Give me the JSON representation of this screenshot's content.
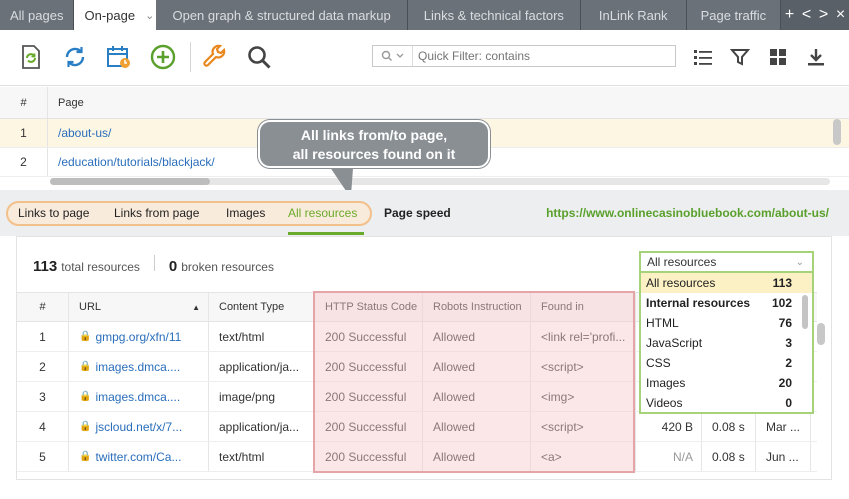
{
  "tabs": [
    {
      "label": "All pages"
    },
    {
      "label": "On-page"
    },
    {
      "label": "Open graph & structured data markup"
    },
    {
      "label": "Links & technical factors"
    },
    {
      "label": "InLink Rank"
    },
    {
      "label": "Page traffic"
    }
  ],
  "tab_controls": [
    "+",
    "<",
    ">",
    "×"
  ],
  "filter": {
    "placeholder": "Quick Filter: contains"
  },
  "pages_table": {
    "headers": {
      "num": "#",
      "page": "Page"
    },
    "rows": [
      {
        "num": "1",
        "page": "/about-us/"
      },
      {
        "num": "2",
        "page": "/education/tutorials/blackjack/"
      }
    ]
  },
  "callout": {
    "line1": "All links from/to page,",
    "line2": "all resources found on it"
  },
  "subtabs": [
    "Links to page",
    "Links from page",
    "Images",
    "All resources",
    "Page speed"
  ],
  "page_url": "https://www.onlinecasinobluebook.com/about-us/",
  "stats": {
    "total": "113",
    "total_label": "total resources",
    "broken": "0",
    "broken_label": "broken resources"
  },
  "resources_table": {
    "headers": {
      "num": "#",
      "url": "URL",
      "content_type": "Content Type",
      "http_status": "HTTP Status Code",
      "robots": "Robots Instruction",
      "found_in": "Found in"
    },
    "rows": [
      {
        "num": "1",
        "url": "gmpg.org/xfn/11",
        "content_type": "text/html",
        "http_status": "200 Successful",
        "robots": "Allowed",
        "found_in": "<link rel='profi...",
        "size": "",
        "time": "",
        "date": ""
      },
      {
        "num": "2",
        "url": "images.dmca....",
        "content_type": "application/ja...",
        "http_status": "200 Successful",
        "robots": "Allowed",
        "found_in": "<script>",
        "size": "",
        "time": "",
        "date": ""
      },
      {
        "num": "3",
        "url": "images.dmca....",
        "content_type": "image/png",
        "http_status": "200 Successful",
        "robots": "Allowed",
        "found_in": "<img>",
        "size": "",
        "time": "",
        "date": ""
      },
      {
        "num": "4",
        "url": "jscloud.net/x/7...",
        "content_type": "application/ja...",
        "http_status": "200 Successful",
        "robots": "Allowed",
        "found_in": "<script>",
        "size": "420 B",
        "time": "0.08 s",
        "date": "Mar ..."
      },
      {
        "num": "5",
        "url": "twitter.com/Ca...",
        "content_type": "text/html",
        "http_status": "200 Successful",
        "robots": "Allowed",
        "found_in": "<a>",
        "size": "N/A",
        "time": "0.08 s",
        "date": "Jun ..."
      }
    ]
  },
  "dropdown": {
    "selected": "All resources",
    "items": [
      {
        "label": "All resources",
        "count": "113"
      },
      {
        "label": "Internal resources",
        "count": "102"
      },
      {
        "label": "HTML",
        "count": "76"
      },
      {
        "label": "JavaScript",
        "count": "3"
      },
      {
        "label": "CSS",
        "count": "2"
      },
      {
        "label": "Images",
        "count": "20"
      },
      {
        "label": "Videos",
        "count": "0"
      }
    ]
  },
  "colors": {
    "accent_green": "#6aaa2a",
    "link_blue": "#2a6ebb",
    "highlight_pink": "#f6c7cb",
    "tab_bar": "#5a6068"
  }
}
